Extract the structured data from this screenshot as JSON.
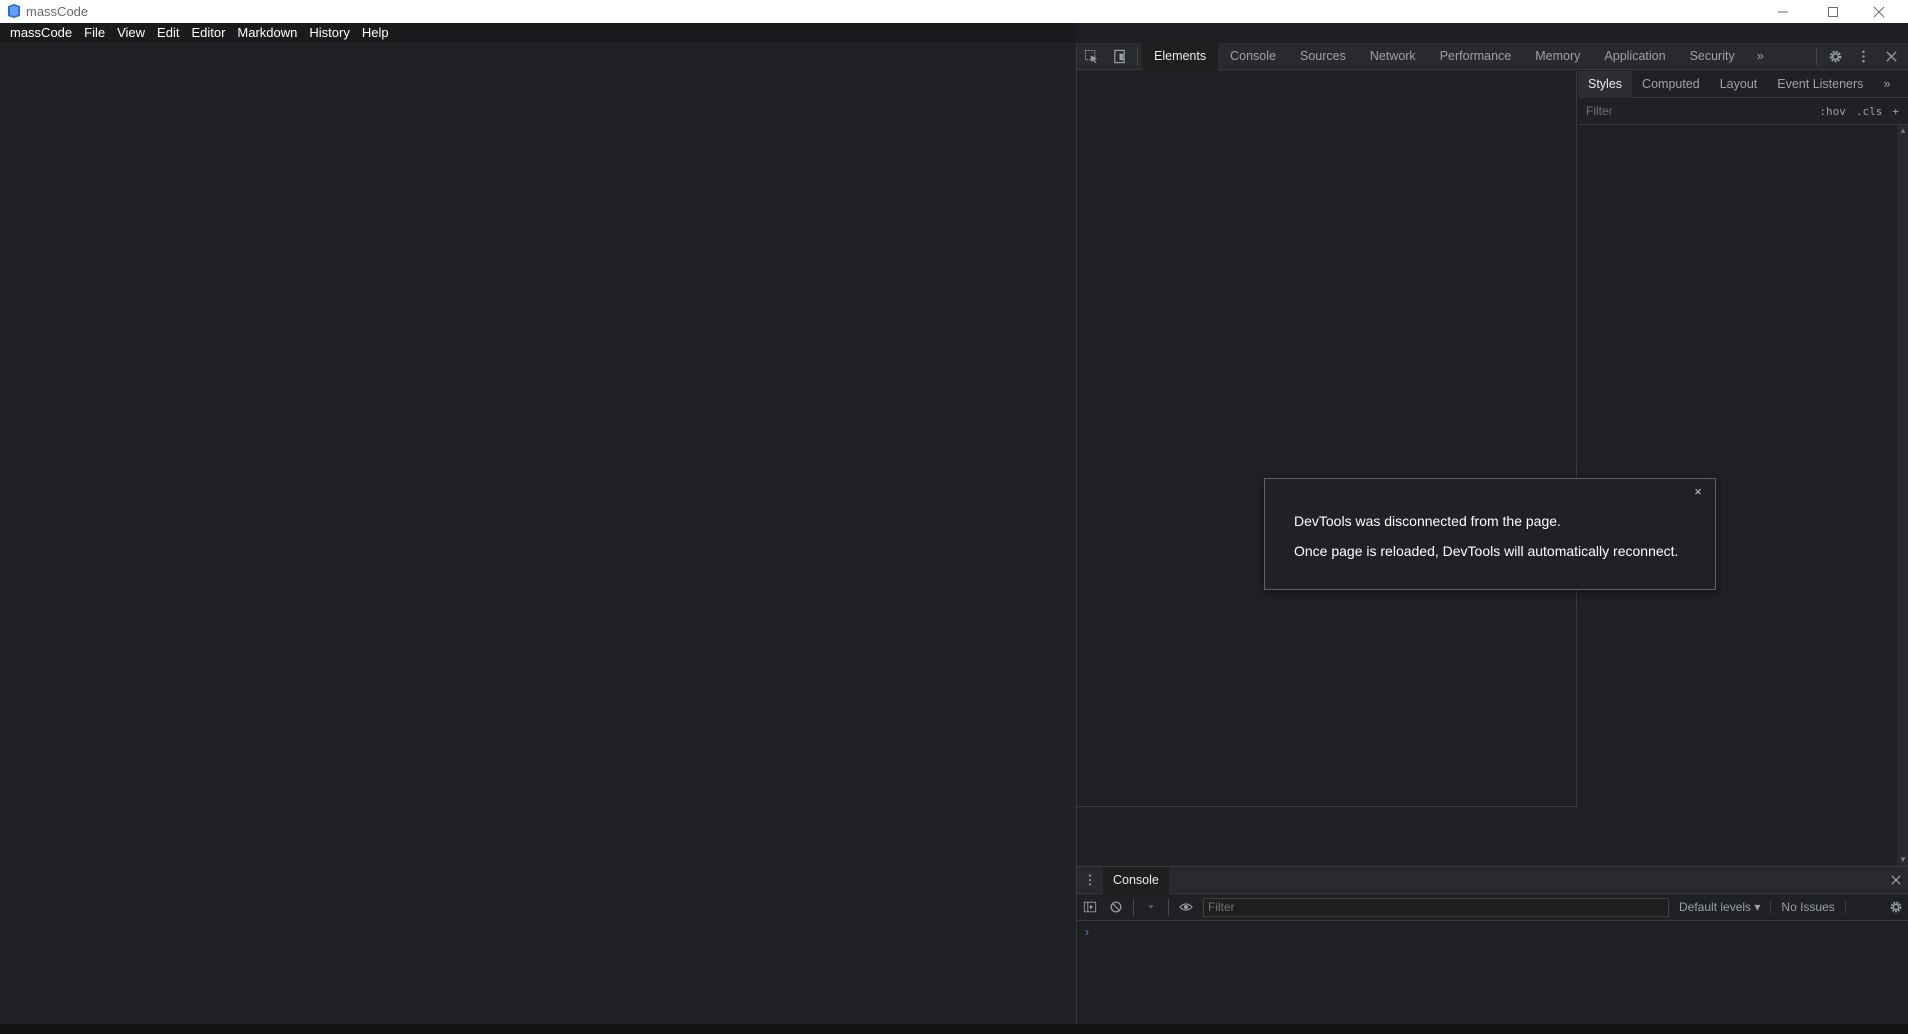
{
  "window": {
    "title": "massCode",
    "icon": "masscode-logo-icon",
    "controls": [
      "minimize-icon",
      "maximize-icon",
      "close-icon"
    ]
  },
  "menu": {
    "items": [
      "massCode",
      "File",
      "View",
      "Edit",
      "Editor",
      "Markdown",
      "History",
      "Help"
    ]
  },
  "devtools": {
    "tabs": [
      "Elements",
      "Console",
      "Sources",
      "Network",
      "Performance",
      "Memory",
      "Application",
      "Security"
    ],
    "active_tab": "Elements",
    "more": "»",
    "sidebar_tabs": [
      "Styles",
      "Computed",
      "Layout",
      "Event Listeners"
    ],
    "active_sidebar_tab": "Styles",
    "styles_filter_placeholder": "Filter",
    "hov": ":hov",
    "cls": ".cls",
    "add": "+"
  },
  "drawer": {
    "tab": "Console",
    "filter_placeholder": "Filter",
    "levels": "Default levels ▾",
    "issues": "No Issues",
    "prompt": "›"
  },
  "dialog": {
    "line1": "DevTools was disconnected from the page.",
    "line2": "Once page is reloaded, DevTools will automatically reconnect.",
    "close": "×"
  },
  "colors": {
    "background": "#202124",
    "accent": "#3a8fd9"
  }
}
